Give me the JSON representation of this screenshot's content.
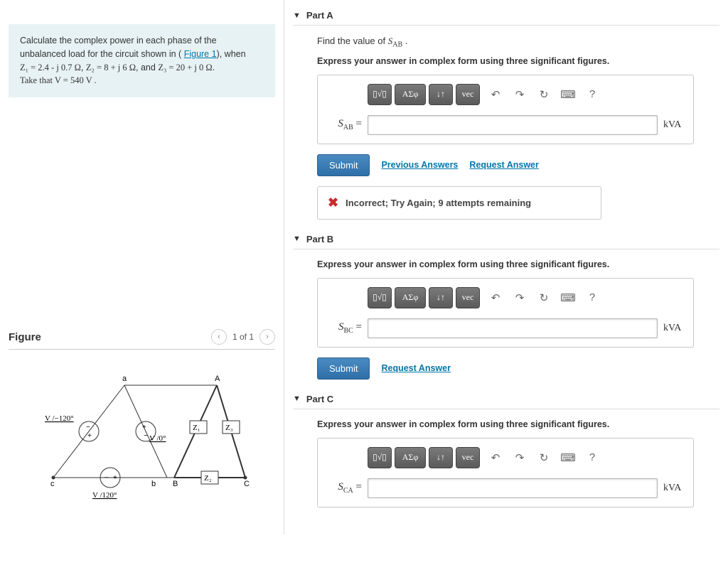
{
  "problem": {
    "intro": "Calculate the complex power in each phase of the unbalanced load for the circuit shown in (",
    "figure_link": "Figure 1",
    "intro2": "), when",
    "z1": "Z₁ = 2.4 - j 0.7 Ω",
    "z2": "Z₂ = 8 + j 6 Ω",
    "z3": "Z₃ = 20 + j 0 Ω",
    "take": "Take that V = 540  V ."
  },
  "figure": {
    "title": "Figure",
    "counter": "1 of 1"
  },
  "diagram": {
    "v_minus120": "V /−120°",
    "v_0": "V /0°",
    "v_120": "V /120°",
    "Z1": "Z₁",
    "Z2": "Z₂",
    "Z3": "Z₃",
    "a": "a",
    "b": "b",
    "c": "c",
    "A": "A",
    "B": "B",
    "C": "C"
  },
  "parts": [
    {
      "label": "Part A",
      "find_html": "Find the value of <span class='ital'>S</span><span class='sub serif'>AB</span> .",
      "instr": "Express your answer in complex form using three significant figures.",
      "lhs_html": "<span class='ital'>S</span><span class='sub'>AB</span> =",
      "unit": "kVA",
      "submit": "Submit",
      "links": [
        "Previous Answers",
        "Request Answer"
      ],
      "feedback": "Incorrect; Try Again; 9 attempts remaining"
    },
    {
      "label": "Part B",
      "instr": "Express your answer in complex form using three significant figures.",
      "lhs_html": "<span class='ital'>S</span><span class='sub'>BC</span> =",
      "unit": "kVA",
      "submit": "Submit",
      "links": [
        "Request Answer"
      ]
    },
    {
      "label": "Part C",
      "instr": "Express your answer in complex form using three significant figures.",
      "lhs_html": "<span class='ital'>S</span><span class='sub'>CA</span> =",
      "unit": "kVA"
    }
  ],
  "toolbar": {
    "btn1": "▯√▯",
    "btn2": "ΑΣφ",
    "btn3": "↓↑",
    "btn4": "vec",
    "undo": "↶",
    "redo": "↷",
    "reset": "↻",
    "kbd": "⌨",
    "help": "?"
  }
}
